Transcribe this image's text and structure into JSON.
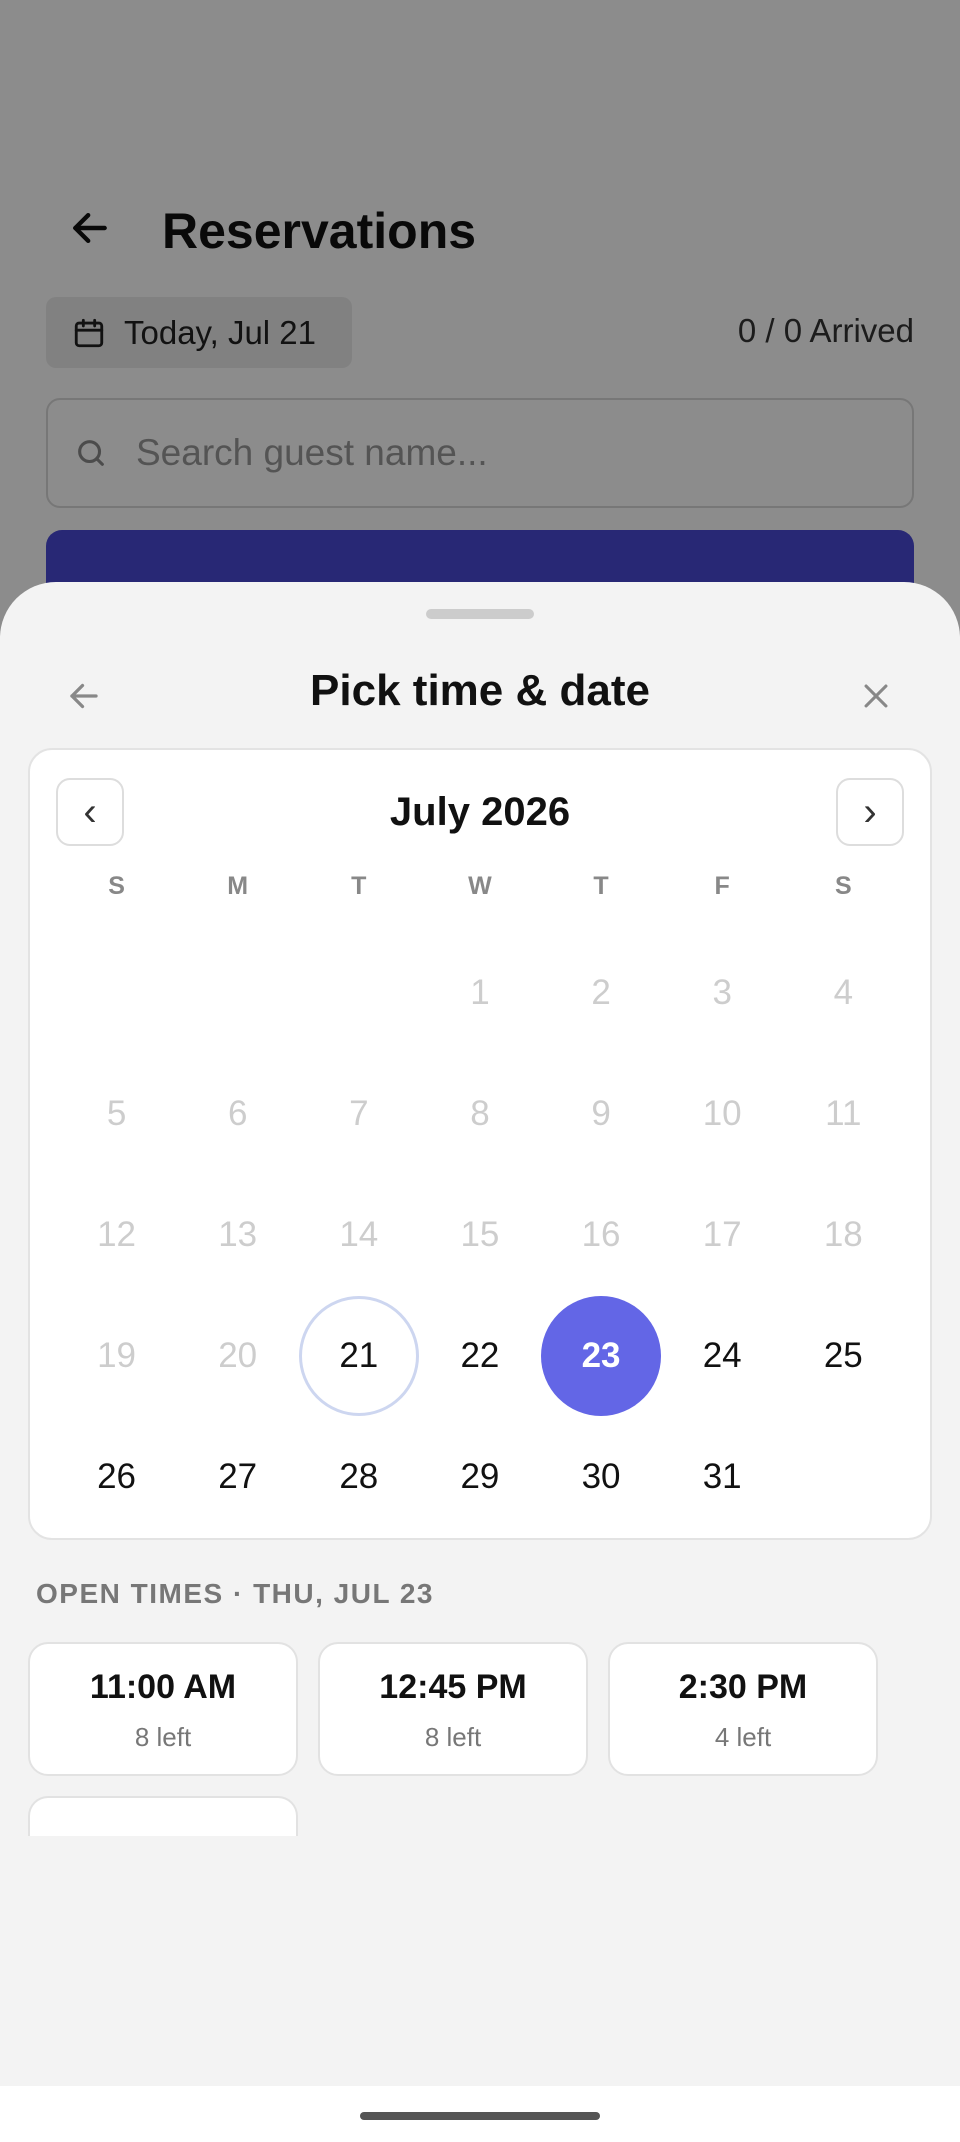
{
  "background": {
    "title": "Reservations",
    "date_chip": "Today, Jul 21",
    "arrived": "0 / 0 Arrived",
    "search_placeholder": "Search guest name..."
  },
  "sheet": {
    "title": "Pick time & date",
    "calendar": {
      "month_label": "July 2026",
      "prev_label": "‹",
      "next_label": "›",
      "weekdays": [
        "S",
        "M",
        "T",
        "W",
        "T",
        "F",
        "S"
      ]
    },
    "open_times_label": "OPEN TIMES · THU, JUL 23",
    "slots": [
      {
        "time": "11:00 AM",
        "left": "8 left"
      },
      {
        "time": "12:45 PM",
        "left": "8 left"
      },
      {
        "time": "2:30 PM",
        "left": "4 left"
      }
    ]
  },
  "colors": {
    "accent": "#6366e6",
    "primary_button": "#4a4ad6",
    "today_ring": "#cdd6f0",
    "disabled_text": "#cdcdcd"
  }
}
